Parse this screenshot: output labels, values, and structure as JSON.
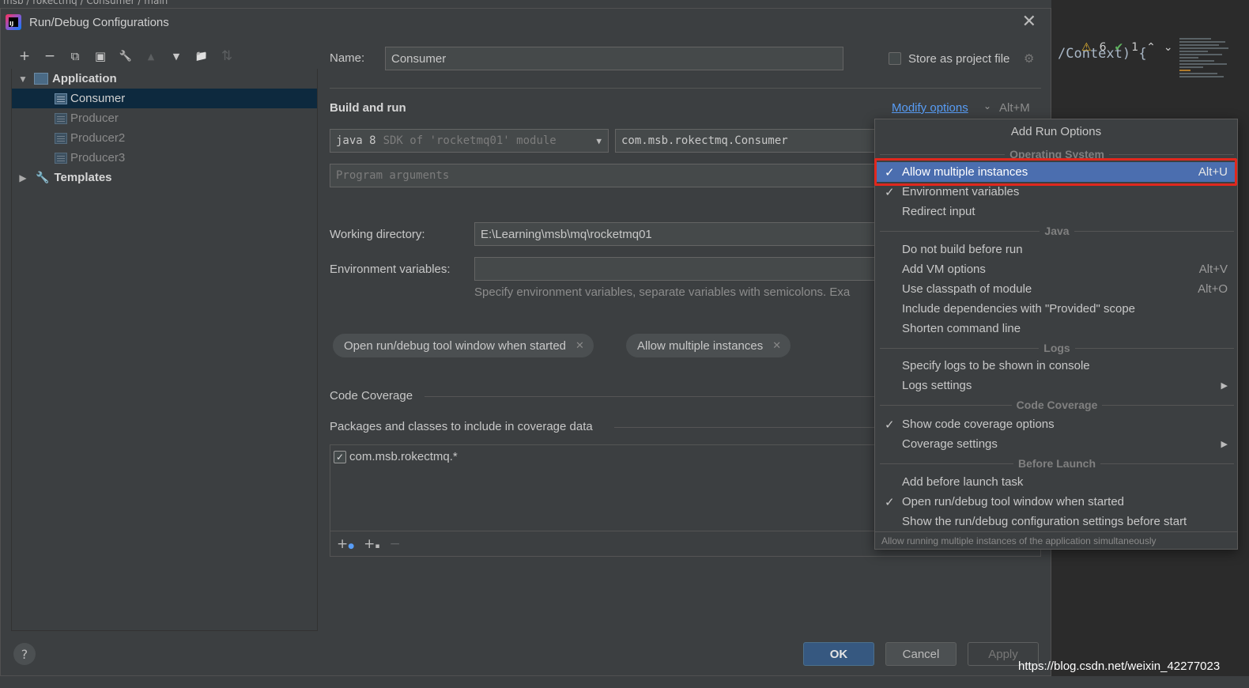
{
  "dialog": {
    "title": "Run/Debug Configurations",
    "close_glyph": "✕"
  },
  "toolbar": {
    "add": "+",
    "remove": "−",
    "copy": "⧉",
    "save": "▣",
    "edit": "🔧",
    "move_up": "▲",
    "move_down": "▼",
    "new_folder": "📁",
    "sort": "⇅"
  },
  "tree": {
    "application": "Application",
    "configs": [
      "Consumer",
      "Producer",
      "Producer2",
      "Producer3"
    ],
    "templates": "Templates"
  },
  "form": {
    "name_label": "Name:",
    "name_value": "Consumer",
    "store_label": "Store as project file",
    "build_run": "Build and run",
    "modify_options": "Modify options",
    "modify_shortcut": "Alt+M",
    "sdk_value": "java 8",
    "sdk_hint": "SDK of 'rocketmq01' module",
    "main_class": "com.msb.rokectmq.Consumer",
    "program_args_placeholder": "Program arguments",
    "working_dir_label": "Working directory:",
    "working_dir_value": "E:\\Learning\\msb\\mq\\rocketmq01",
    "env_label": "Environment variables:",
    "env_hint": "Specify environment variables, separate variables with semicolons. Exa",
    "chips": [
      "Open run/debug tool window when started",
      "Allow multiple instances"
    ],
    "code_coverage": "Code Coverage",
    "packages_label": "Packages and classes to include in coverage data",
    "package_item": "com.msb.rokectmq.*"
  },
  "buttons": {
    "ok": "OK",
    "cancel": "Cancel",
    "apply": "Apply",
    "help": "?"
  },
  "popup": {
    "title": "Add Run Options",
    "sections": {
      "os": "Operating System",
      "java": "Java",
      "logs": "Logs",
      "coverage": "Code Coverage",
      "before_launch": "Before Launch"
    },
    "items": {
      "allow_multiple": {
        "label": "Allow multiple instances",
        "shortcut": "Alt+U"
      },
      "env_vars": {
        "label": "Environment variables"
      },
      "redirect_input": {
        "label": "Redirect input"
      },
      "no_build": {
        "label": "Do not build before run"
      },
      "vm_options": {
        "label": "Add VM options",
        "shortcut": "Alt+V"
      },
      "classpath": {
        "label": "Use classpath of module",
        "shortcut": "Alt+O"
      },
      "provided": {
        "label": "Include dependencies with \"Provided\" scope"
      },
      "shorten": {
        "label": "Shorten command line"
      },
      "logs_console": {
        "label": "Specify logs to be shown in console"
      },
      "logs_settings": {
        "label": "Logs settings"
      },
      "show_coverage": {
        "label": "Show code coverage options"
      },
      "coverage_settings": {
        "label": "Coverage settings"
      },
      "before_task": {
        "label": "Add before launch task"
      },
      "open_tool_window": {
        "label": "Open run/debug tool window when started"
      },
      "show_settings": {
        "label": "Show the run/debug configuration settings before start"
      }
    },
    "footer": "Allow running multiple instances of the application simultaneously"
  },
  "background": {
    "breadcrumb": "msb / rokectmq / Consumer / main",
    "code_fragment": "/Context) {",
    "warnings": "6",
    "checks": "1"
  },
  "watermark": "https://blog.csdn.net/weixin_42277023",
  "colors": {
    "accent": "#4b6eaf",
    "highlight_frame": "#e0281e",
    "link": "#589df6",
    "ok_button": "#365880"
  }
}
